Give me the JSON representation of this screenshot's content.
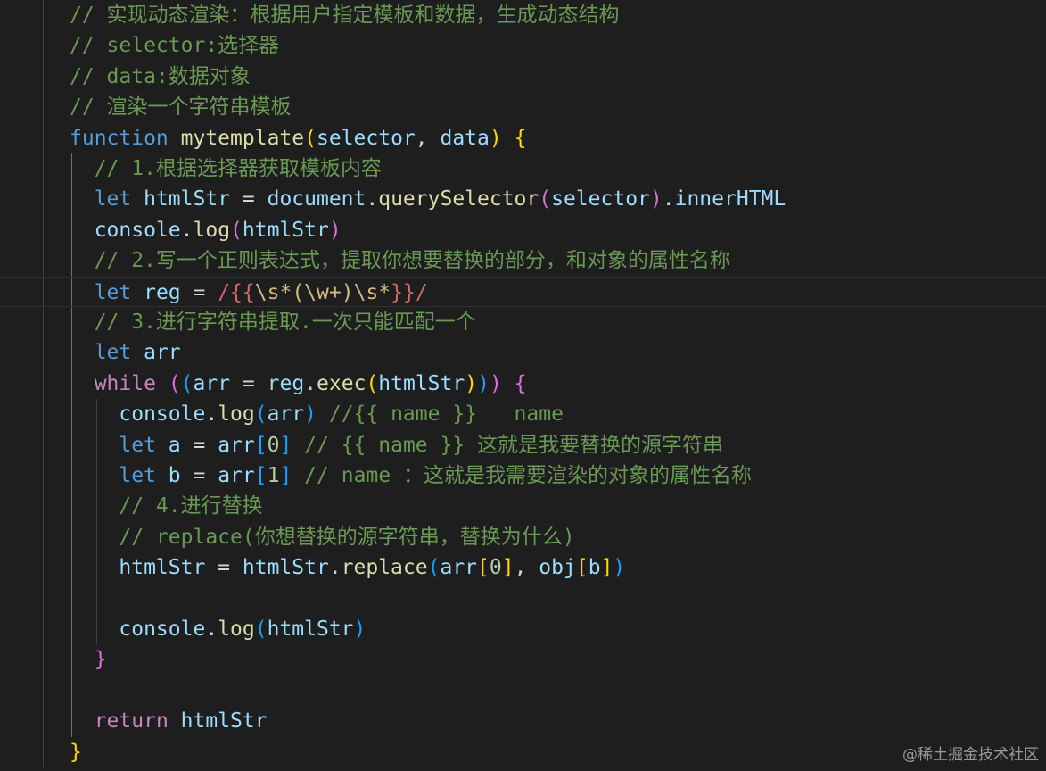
{
  "colors": {
    "background": "#1e1e1e",
    "comment": "#6a9955",
    "keyword": "#569cd6",
    "control": "#c586c0",
    "function": "#dcdcaa",
    "variable": "#9cdcfe",
    "regex": "#d16969",
    "regex_escape": "#d7ba7d",
    "number": "#b5cea8",
    "plain": "#d4d4d4",
    "bracket_gold": "#ffd700",
    "bracket_pink": "#da70d6",
    "bracket_blue": "#179fff",
    "guide": "#404040",
    "guide_active": "#707070"
  },
  "watermark": "@稀土掘金技术社区",
  "lines": [
    {
      "name": "comment-render-desc",
      "tokens": [
        {
          "t": "// 实现动态渲染：根据用户指定模板和数据，生成动态结构",
          "c": "comment"
        }
      ]
    },
    {
      "name": "comment-selector",
      "tokens": [
        {
          "t": "// selector:选择器",
          "c": "comment"
        }
      ]
    },
    {
      "name": "comment-data",
      "tokens": [
        {
          "t": "// data:数据对象",
          "c": "comment"
        }
      ]
    },
    {
      "name": "comment-template",
      "tokens": [
        {
          "t": "// 渲染一个字符串模板",
          "c": "comment"
        }
      ]
    },
    {
      "name": "function-declaration",
      "tokens": [
        {
          "t": "function",
          "c": "keyword"
        },
        {
          "t": " ",
          "c": "plain"
        },
        {
          "t": "mytemplate",
          "c": "function"
        },
        {
          "t": "(",
          "c": "bracket_gold"
        },
        {
          "t": "selector",
          "c": "variable"
        },
        {
          "t": ", ",
          "c": "plain"
        },
        {
          "t": "data",
          "c": "variable"
        },
        {
          "t": ")",
          "c": "bracket_gold"
        },
        {
          "t": " ",
          "c": "plain"
        },
        {
          "t": "{",
          "c": "bracket_gold"
        }
      ]
    },
    {
      "name": "comment-step-1",
      "tokens": [
        {
          "t": "  // 1.根据选择器获取模板内容",
          "c": "comment"
        }
      ]
    },
    {
      "name": "let-htmlstr",
      "tokens": [
        {
          "t": "  ",
          "c": "plain"
        },
        {
          "t": "let",
          "c": "keyword"
        },
        {
          "t": " ",
          "c": "plain"
        },
        {
          "t": "htmlStr",
          "c": "variable"
        },
        {
          "t": " = ",
          "c": "plain"
        },
        {
          "t": "document",
          "c": "variable"
        },
        {
          "t": ".",
          "c": "plain"
        },
        {
          "t": "querySelector",
          "c": "function"
        },
        {
          "t": "(",
          "c": "bracket_pink"
        },
        {
          "t": "selector",
          "c": "variable"
        },
        {
          "t": ")",
          "c": "bracket_pink"
        },
        {
          "t": ".",
          "c": "plain"
        },
        {
          "t": "innerHTML",
          "c": "variable"
        }
      ]
    },
    {
      "name": "console-log-1",
      "tokens": [
        {
          "t": "  ",
          "c": "plain"
        },
        {
          "t": "console",
          "c": "variable"
        },
        {
          "t": ".",
          "c": "plain"
        },
        {
          "t": "log",
          "c": "function"
        },
        {
          "t": "(",
          "c": "bracket_pink"
        },
        {
          "t": "htmlStr",
          "c": "variable"
        },
        {
          "t": ")",
          "c": "bracket_pink"
        }
      ]
    },
    {
      "name": "comment-step-2",
      "tokens": [
        {
          "t": "  // 2.写一个正则表达式，提取你想要替换的部分，和对象的属性名称",
          "c": "comment"
        }
      ]
    },
    {
      "name": "let-reg",
      "current": true,
      "tokens": [
        {
          "t": "  ",
          "c": "plain"
        },
        {
          "t": "let",
          "c": "keyword"
        },
        {
          "t": " ",
          "c": "plain"
        },
        {
          "t": "reg",
          "c": "variable"
        },
        {
          "t": " = ",
          "c": "plain"
        },
        {
          "t": "/{{",
          "c": "regex"
        },
        {
          "t": "\\s",
          "c": "regex_escape"
        },
        {
          "t": "*",
          "c": "regex_escape"
        },
        {
          "t": "(",
          "c": "regex_escape"
        },
        {
          "t": "\\w",
          "c": "regex_escape"
        },
        {
          "t": "+",
          "c": "regex_escape"
        },
        {
          "t": ")",
          "c": "regex_escape"
        },
        {
          "t": "\\s",
          "c": "regex_escape"
        },
        {
          "t": "*",
          "c": "regex_escape"
        },
        {
          "t": "}}/",
          "c": "regex"
        }
      ]
    },
    {
      "name": "comment-step-3",
      "tokens": [
        {
          "t": "  // 3.进行字符串提取.一次只能匹配一个",
          "c": "comment"
        }
      ]
    },
    {
      "name": "let-arr",
      "tokens": [
        {
          "t": "  ",
          "c": "plain"
        },
        {
          "t": "let",
          "c": "keyword"
        },
        {
          "t": " ",
          "c": "plain"
        },
        {
          "t": "arr",
          "c": "variable"
        }
      ]
    },
    {
      "name": "while-loop",
      "tokens": [
        {
          "t": "  ",
          "c": "plain"
        },
        {
          "t": "while",
          "c": "control"
        },
        {
          "t": " ",
          "c": "plain"
        },
        {
          "t": "(",
          "c": "bracket_pink"
        },
        {
          "t": "(",
          "c": "bracket_blue"
        },
        {
          "t": "arr",
          "c": "variable"
        },
        {
          "t": " = ",
          "c": "plain"
        },
        {
          "t": "reg",
          "c": "variable"
        },
        {
          "t": ".",
          "c": "plain"
        },
        {
          "t": "exec",
          "c": "function"
        },
        {
          "t": "(",
          "c": "bracket_gold"
        },
        {
          "t": "htmlStr",
          "c": "variable"
        },
        {
          "t": ")",
          "c": "bracket_gold"
        },
        {
          "t": ")",
          "c": "bracket_blue"
        },
        {
          "t": ")",
          "c": "bracket_pink"
        },
        {
          "t": " ",
          "c": "plain"
        },
        {
          "t": "{",
          "c": "bracket_pink"
        }
      ]
    },
    {
      "name": "console-log-arr",
      "tokens": [
        {
          "t": "    ",
          "c": "plain"
        },
        {
          "t": "console",
          "c": "variable"
        },
        {
          "t": ".",
          "c": "plain"
        },
        {
          "t": "log",
          "c": "function"
        },
        {
          "t": "(",
          "c": "bracket_blue"
        },
        {
          "t": "arr",
          "c": "variable"
        },
        {
          "t": ")",
          "c": "bracket_blue"
        },
        {
          "t": " //{{ name }}   name",
          "c": "comment"
        }
      ]
    },
    {
      "name": "let-a",
      "tokens": [
        {
          "t": "    ",
          "c": "plain"
        },
        {
          "t": "let",
          "c": "keyword"
        },
        {
          "t": " ",
          "c": "plain"
        },
        {
          "t": "a",
          "c": "variable"
        },
        {
          "t": " = ",
          "c": "plain"
        },
        {
          "t": "arr",
          "c": "variable"
        },
        {
          "t": "[",
          "c": "bracket_blue"
        },
        {
          "t": "0",
          "c": "number"
        },
        {
          "t": "]",
          "c": "bracket_blue"
        },
        {
          "t": " // {{ name }} 这就是我要替换的源字符串",
          "c": "comment"
        }
      ]
    },
    {
      "name": "let-b",
      "tokens": [
        {
          "t": "    ",
          "c": "plain"
        },
        {
          "t": "let",
          "c": "keyword"
        },
        {
          "t": " ",
          "c": "plain"
        },
        {
          "t": "b",
          "c": "variable"
        },
        {
          "t": " = ",
          "c": "plain"
        },
        {
          "t": "arr",
          "c": "variable"
        },
        {
          "t": "[",
          "c": "bracket_blue"
        },
        {
          "t": "1",
          "c": "number"
        },
        {
          "t": "]",
          "c": "bracket_blue"
        },
        {
          "t": " // name ：这就是我需要渲染的对象的属性名称",
          "c": "comment"
        }
      ]
    },
    {
      "name": "comment-step-4",
      "tokens": [
        {
          "t": "    // 4.进行替换",
          "c": "comment"
        }
      ]
    },
    {
      "name": "comment-replace",
      "tokens": [
        {
          "t": "    // replace(你想替换的源字符串，替换为什么)",
          "c": "comment"
        }
      ]
    },
    {
      "name": "htmlstr-replace",
      "tokens": [
        {
          "t": "    ",
          "c": "plain"
        },
        {
          "t": "htmlStr",
          "c": "variable"
        },
        {
          "t": " = ",
          "c": "plain"
        },
        {
          "t": "htmlStr",
          "c": "variable"
        },
        {
          "t": ".",
          "c": "plain"
        },
        {
          "t": "replace",
          "c": "function"
        },
        {
          "t": "(",
          "c": "bracket_blue"
        },
        {
          "t": "arr",
          "c": "variable"
        },
        {
          "t": "[",
          "c": "bracket_gold"
        },
        {
          "t": "0",
          "c": "number"
        },
        {
          "t": "]",
          "c": "bracket_gold"
        },
        {
          "t": ", ",
          "c": "plain"
        },
        {
          "t": "obj",
          "c": "variable"
        },
        {
          "t": "[",
          "c": "bracket_gold"
        },
        {
          "t": "b",
          "c": "variable"
        },
        {
          "t": "]",
          "c": "bracket_gold"
        },
        {
          "t": ")",
          "c": "bracket_blue"
        }
      ]
    },
    {
      "name": "blank-line-1",
      "tokens": []
    },
    {
      "name": "console-log-2",
      "tokens": [
        {
          "t": "    ",
          "c": "plain"
        },
        {
          "t": "console",
          "c": "variable"
        },
        {
          "t": ".",
          "c": "plain"
        },
        {
          "t": "log",
          "c": "function"
        },
        {
          "t": "(",
          "c": "bracket_blue"
        },
        {
          "t": "htmlStr",
          "c": "variable"
        },
        {
          "t": ")",
          "c": "bracket_blue"
        }
      ]
    },
    {
      "name": "while-close",
      "tokens": [
        {
          "t": "  ",
          "c": "plain"
        },
        {
          "t": "}",
          "c": "bracket_pink"
        }
      ]
    },
    {
      "name": "blank-line-2",
      "tokens": []
    },
    {
      "name": "return-statement",
      "tokens": [
        {
          "t": "  ",
          "c": "plain"
        },
        {
          "t": "return",
          "c": "control"
        },
        {
          "t": " ",
          "c": "plain"
        },
        {
          "t": "htmlStr",
          "c": "variable"
        }
      ]
    },
    {
      "name": "function-close",
      "tokens": [
        {
          "t": "}",
          "c": "bracket_gold"
        }
      ]
    }
  ]
}
